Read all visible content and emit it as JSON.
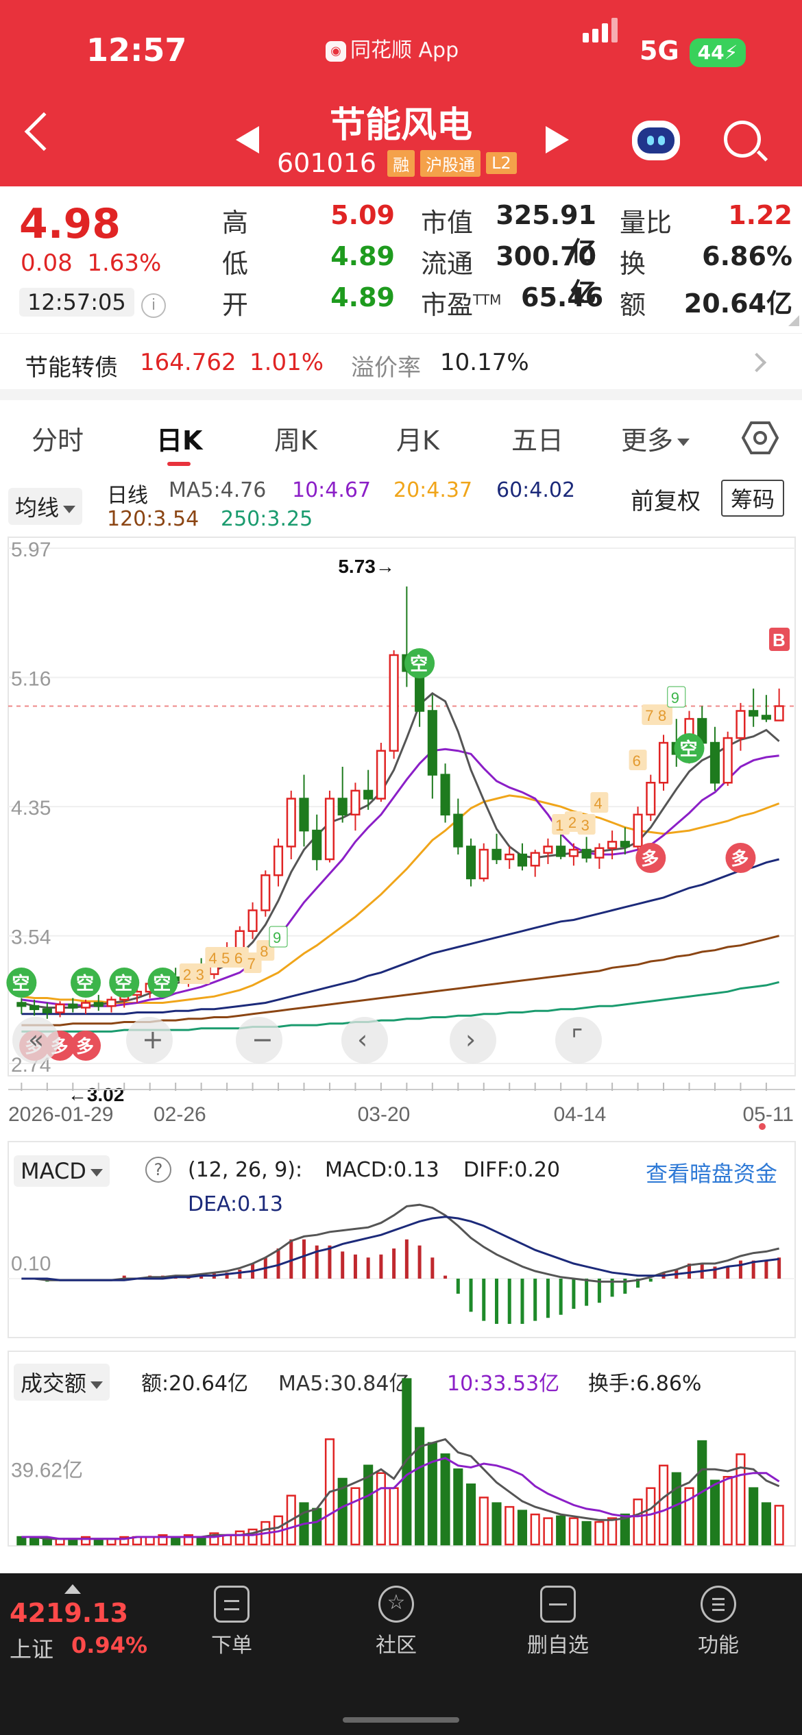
{
  "status_bar": {
    "time": "12:57",
    "app": "同花顺 App",
    "app_icon": "ths-logo",
    "network": "5G",
    "battery": "44"
  },
  "header": {
    "name": "节能风电",
    "code": "601016",
    "tags": [
      "融",
      "沪股通",
      "L2"
    ]
  },
  "quote": {
    "price": "4.98",
    "change": "0.08",
    "change_pct": "1.63%",
    "time": "12:57:05",
    "high_label": "高",
    "high": "5.09",
    "low_label": "低",
    "low": "4.89",
    "open_label": "开",
    "open": "4.89",
    "mktcap_label": "市值",
    "mktcap": "325.91亿",
    "float_label": "流通",
    "float": "300.70亿",
    "pe_label": "市盈",
    "pe_sup": "TTM",
    "pe": "65.46",
    "vr_label": "量比",
    "vr": "1.22",
    "turnover_label": "换",
    "turnover": "6.86%",
    "amount_label": "额",
    "amount": "20.64亿"
  },
  "bond": {
    "name": "节能转债",
    "price": "164.762",
    "pct": "1.01%",
    "premium_label": "溢价率",
    "premium": "10.17%"
  },
  "tabs": [
    "分时",
    "日K",
    "周K",
    "月K",
    "五日",
    "更多"
  ],
  "active_tab": "日K",
  "kline_header": {
    "selector": "均线",
    "label": "日线",
    "ma5": "MA5:4.76",
    "ma10": "10:4.67",
    "ma20": "20:4.37",
    "ma60": "60:4.02",
    "ma120": "120:3.54",
    "ma250": "250:3.25",
    "adjust": "前复权",
    "chip": "筹码"
  },
  "colors": {
    "up": "#e02424",
    "down": "#1e7b1e",
    "ma5": "#555555",
    "ma10": "#8b1fc7",
    "ma20": "#f0a51a",
    "ma60": "#1c2a7a",
    "ma120": "#8b4513",
    "ma250": "#1a9b6e"
  },
  "chart_data": [
    {
      "type": "candlestick",
      "title": "",
      "y_ticks": [
        "5.97",
        "5.16",
        "4.35",
        "3.54",
        "2.74"
      ],
      "ylim": [
        2.74,
        5.97
      ],
      "x_ticks": [
        "2026-01-29",
        "02-26",
        "03-20",
        "04-14",
        "05-11"
      ],
      "annotations": {
        "high_label": "5.73→",
        "low_label": "←3.02",
        "signal_empty": "空",
        "signal_long": "多",
        "signal_b": "B"
      },
      "counts": [
        "2",
        "3",
        "4",
        "5",
        "6",
        "7",
        "8",
        "9",
        "1",
        "2",
        "3",
        "4",
        "6",
        "7",
        "8",
        "9"
      ],
      "candles": [
        [
          3.12,
          3.15,
          3.05,
          3.1
        ],
        [
          3.1,
          3.14,
          3.04,
          3.08
        ],
        [
          3.08,
          3.12,
          3.02,
          3.06
        ],
        [
          3.06,
          3.13,
          3.03,
          3.11
        ],
        [
          3.11,
          3.15,
          3.06,
          3.09
        ],
        [
          3.09,
          3.14,
          3.05,
          3.12
        ],
        [
          3.12,
          3.17,
          3.07,
          3.1
        ],
        [
          3.1,
          3.16,
          3.06,
          3.14
        ],
        [
          3.14,
          3.2,
          3.09,
          3.17
        ],
        [
          3.17,
          3.22,
          3.12,
          3.19
        ],
        [
          3.19,
          3.26,
          3.15,
          3.24
        ],
        [
          3.24,
          3.3,
          3.18,
          3.28
        ],
        [
          3.28,
          3.34,
          3.22,
          3.26
        ],
        [
          3.26,
          3.36,
          3.22,
          3.33
        ],
        [
          3.33,
          3.4,
          3.28,
          3.3
        ],
        [
          3.3,
          3.44,
          3.27,
          3.41
        ],
        [
          3.41,
          3.5,
          3.36,
          3.46
        ],
        [
          3.46,
          3.6,
          3.42,
          3.57
        ],
        [
          3.57,
          3.75,
          3.52,
          3.7
        ],
        [
          3.7,
          3.95,
          3.66,
          3.92
        ],
        [
          3.92,
          4.15,
          3.85,
          4.1
        ],
        [
          4.1,
          4.45,
          4.02,
          4.4
        ],
        [
          4.4,
          4.55,
          4.1,
          4.2
        ],
        [
          4.2,
          4.3,
          3.95,
          4.02
        ],
        [
          4.02,
          4.45,
          4.0,
          4.4
        ],
        [
          4.4,
          4.6,
          4.25,
          4.3
        ],
        [
          4.3,
          4.5,
          4.2,
          4.45
        ],
        [
          4.45,
          4.58,
          4.33,
          4.4
        ],
        [
          4.4,
          4.75,
          4.38,
          4.7
        ],
        [
          4.7,
          5.33,
          4.65,
          5.3
        ],
        [
          5.3,
          5.73,
          5.1,
          5.2
        ],
        [
          5.2,
          5.27,
          4.85,
          4.95
        ],
        [
          4.95,
          5.05,
          4.4,
          4.55
        ],
        [
          4.55,
          4.62,
          4.25,
          4.3
        ],
        [
          4.3,
          4.4,
          4.05,
          4.1
        ],
        [
          4.1,
          4.15,
          3.85,
          3.9
        ],
        [
          3.9,
          4.12,
          3.88,
          4.08
        ],
        [
          4.08,
          4.18,
          3.99,
          4.02
        ],
        [
          4.02,
          4.1,
          3.96,
          4.05
        ],
        [
          4.05,
          4.12,
          3.95,
          3.98
        ],
        [
          3.98,
          4.08,
          3.91,
          4.06
        ],
        [
          4.06,
          4.15,
          3.99,
          4.1
        ],
        [
          4.1,
          4.18,
          4.02,
          4.04
        ],
        [
          4.04,
          4.12,
          3.98,
          4.08
        ],
        [
          4.08,
          4.16,
          4.0,
          4.03
        ],
        [
          4.03,
          4.12,
          3.96,
          4.09
        ],
        [
          4.09,
          4.2,
          4.02,
          4.13
        ],
        [
          4.13,
          4.22,
          4.05,
          4.1
        ],
        [
          4.1,
          4.35,
          4.08,
          4.3
        ],
        [
          4.3,
          4.55,
          4.26,
          4.5
        ],
        [
          4.5,
          4.8,
          4.45,
          4.75
        ],
        [
          4.75,
          4.9,
          4.6,
          4.68
        ],
        [
          4.68,
          4.95,
          4.62,
          4.9
        ],
        [
          4.9,
          4.98,
          4.7,
          4.75
        ],
        [
          4.75,
          4.85,
          4.45,
          4.5
        ],
        [
          4.5,
          4.82,
          4.48,
          4.78
        ],
        [
          4.78,
          5.0,
          4.7,
          4.95
        ],
        [
          4.95,
          5.09,
          4.85,
          4.92
        ],
        [
          4.92,
          5.05,
          4.88,
          4.9
        ],
        [
          4.89,
          5.09,
          4.89,
          4.98
        ]
      ],
      "ma_series": {
        "ma5": [
          3.12,
          3.1,
          3.09,
          3.09,
          3.09,
          3.1,
          3.11,
          3.12,
          3.13,
          3.15,
          3.18,
          3.21,
          3.24,
          3.27,
          3.29,
          3.32,
          3.36,
          3.42,
          3.5,
          3.61,
          3.76,
          3.94,
          4.08,
          4.17,
          4.25,
          4.28,
          4.32,
          4.36,
          4.44,
          4.58,
          4.78,
          4.99,
          5.06,
          5.01,
          4.82,
          4.58,
          4.39,
          4.21,
          4.1,
          4.04,
          4.03,
          4.04,
          4.05,
          4.06,
          4.07,
          4.07,
          4.08,
          4.09,
          4.13,
          4.22,
          4.34,
          4.46,
          4.57,
          4.64,
          4.68,
          4.73,
          4.77,
          4.79,
          4.83,
          4.76
        ],
        "ma10": [
          3.14,
          3.13,
          3.12,
          3.11,
          3.11,
          3.1,
          3.1,
          3.1,
          3.11,
          3.12,
          3.14,
          3.15,
          3.18,
          3.2,
          3.22,
          3.25,
          3.28,
          3.31,
          3.37,
          3.44,
          3.53,
          3.64,
          3.75,
          3.84,
          3.93,
          4.02,
          4.13,
          4.22,
          4.3,
          4.41,
          4.52,
          4.62,
          4.7,
          4.71,
          4.7,
          4.68,
          4.59,
          4.51,
          4.47,
          4.44,
          4.4,
          4.3,
          4.18,
          4.1,
          4.06,
          4.05,
          4.05,
          4.06,
          4.08,
          4.11,
          4.17,
          4.24,
          4.31,
          4.39,
          4.44,
          4.52,
          4.6,
          4.64,
          4.66,
          4.67
        ],
        "ma20": [
          3.16,
          3.15,
          3.15,
          3.14,
          3.14,
          3.13,
          3.13,
          3.12,
          3.12,
          3.12,
          3.12,
          3.12,
          3.13,
          3.14,
          3.15,
          3.16,
          3.18,
          3.2,
          3.23,
          3.27,
          3.31,
          3.37,
          3.43,
          3.48,
          3.54,
          3.6,
          3.66,
          3.73,
          3.8,
          3.88,
          3.96,
          4.05,
          4.14,
          4.2,
          4.27,
          4.34,
          4.38,
          4.4,
          4.42,
          4.41,
          4.39,
          4.37,
          4.35,
          4.32,
          4.3,
          4.28,
          4.25,
          4.22,
          4.2,
          4.19,
          4.18,
          4.19,
          4.2,
          4.22,
          4.24,
          4.26,
          4.29,
          4.31,
          4.34,
          4.37
        ],
        "ma60": [
          3.05,
          3.05,
          3.05,
          3.05,
          3.05,
          3.05,
          3.05,
          3.05,
          3.05,
          3.06,
          3.06,
          3.06,
          3.07,
          3.07,
          3.08,
          3.08,
          3.09,
          3.1,
          3.11,
          3.12,
          3.14,
          3.16,
          3.18,
          3.2,
          3.22,
          3.24,
          3.26,
          3.29,
          3.31,
          3.34,
          3.37,
          3.4,
          3.43,
          3.45,
          3.47,
          3.49,
          3.51,
          3.53,
          3.55,
          3.57,
          3.59,
          3.61,
          3.63,
          3.64,
          3.66,
          3.68,
          3.7,
          3.72,
          3.74,
          3.76,
          3.78,
          3.81,
          3.84,
          3.86,
          3.89,
          3.92,
          3.95,
          3.97,
          4.0,
          4.02
        ],
        "ma120": [
          2.98,
          2.98,
          2.98,
          2.98,
          2.99,
          2.99,
          2.99,
          2.99,
          3.0,
          3.0,
          3.0,
          3.01,
          3.01,
          3.02,
          3.02,
          3.03,
          3.03,
          3.04,
          3.05,
          3.06,
          3.07,
          3.08,
          3.09,
          3.1,
          3.11,
          3.12,
          3.13,
          3.14,
          3.15,
          3.16,
          3.17,
          3.18,
          3.19,
          3.2,
          3.21,
          3.22,
          3.23,
          3.24,
          3.25,
          3.26,
          3.27,
          3.28,
          3.29,
          3.3,
          3.31,
          3.32,
          3.34,
          3.35,
          3.36,
          3.38,
          3.39,
          3.41,
          3.42,
          3.44,
          3.45,
          3.47,
          3.48,
          3.5,
          3.52,
          3.54
        ],
        "ma250": [
          2.94,
          2.94,
          2.94,
          2.94,
          2.94,
          2.94,
          2.94,
          2.94,
          2.95,
          2.95,
          2.95,
          2.95,
          2.95,
          2.95,
          2.96,
          2.96,
          2.96,
          2.96,
          2.97,
          2.97,
          2.97,
          2.98,
          2.98,
          2.98,
          2.99,
          2.99,
          3.0,
          3.0,
          3.01,
          3.01,
          3.02,
          3.02,
          3.03,
          3.03,
          3.04,
          3.04,
          3.05,
          3.05,
          3.06,
          3.06,
          3.07,
          3.07,
          3.08,
          3.08,
          3.09,
          3.1,
          3.1,
          3.11,
          3.12,
          3.13,
          3.14,
          3.15,
          3.16,
          3.17,
          3.18,
          3.19,
          3.21,
          3.22,
          3.23,
          3.25
        ]
      }
    },
    {
      "type": "macd",
      "selector": "MACD",
      "params": "(12, 26, 9):",
      "macd_label": "MACD:0.13",
      "diff_label": "DIFF:0.20",
      "dea_label": "DEA:0.13",
      "link": "查看暗盘资金",
      "y_tick": "0.10",
      "diff": [
        0.0,
        0.0,
        -0.01,
        -0.01,
        -0.01,
        -0.01,
        -0.01,
        -0.01,
        0.0,
        0.0,
        0.01,
        0.01,
        0.02,
        0.02,
        0.03,
        0.04,
        0.05,
        0.07,
        0.1,
        0.14,
        0.19,
        0.25,
        0.28,
        0.29,
        0.31,
        0.32,
        0.33,
        0.34,
        0.37,
        0.42,
        0.48,
        0.49,
        0.47,
        0.42,
        0.35,
        0.27,
        0.21,
        0.16,
        0.12,
        0.08,
        0.05,
        0.03,
        0.01,
        0.0,
        -0.01,
        -0.02,
        -0.02,
        -0.02,
        -0.01,
        0.01,
        0.04,
        0.06,
        0.09,
        0.1,
        0.1,
        0.12,
        0.15,
        0.17,
        0.18,
        0.2
      ],
      "dea": [
        0.0,
        0.0,
        0.0,
        -0.01,
        -0.01,
        -0.01,
        -0.01,
        -0.01,
        -0.01,
        0.0,
        0.0,
        0.0,
        0.01,
        0.01,
        0.02,
        0.02,
        0.03,
        0.04,
        0.05,
        0.07,
        0.09,
        0.12,
        0.15,
        0.18,
        0.2,
        0.23,
        0.25,
        0.27,
        0.29,
        0.32,
        0.35,
        0.38,
        0.4,
        0.41,
        0.4,
        0.38,
        0.35,
        0.31,
        0.27,
        0.23,
        0.19,
        0.16,
        0.13,
        0.1,
        0.08,
        0.06,
        0.04,
        0.03,
        0.02,
        0.02,
        0.02,
        0.03,
        0.04,
        0.05,
        0.06,
        0.08,
        0.09,
        0.11,
        0.12,
        0.13
      ]
    },
    {
      "type": "bar",
      "selector": "成交额",
      "amount_label": "额:20.64亿",
      "ma5_label": "MA5:30.84亿",
      "ma10_label": "10:33.53亿",
      "turnover_label": "换手:6.86%",
      "y_tick": "39.62亿",
      "ylim": [
        0,
        78
      ],
      "values": [
        4,
        3,
        3,
        3,
        3,
        4,
        3,
        3,
        4,
        4,
        4,
        5,
        4,
        5,
        4,
        6,
        5,
        7,
        8,
        12,
        15,
        26,
        22,
        19,
        56,
        35,
        30,
        42,
        38,
        30,
        88,
        62,
        54,
        48,
        40,
        32,
        25,
        22,
        20,
        18,
        16,
        14,
        15,
        14,
        12,
        12,
        14,
        16,
        24,
        30,
        42,
        38,
        30,
        55,
        34,
        36,
        48,
        30,
        22,
        20.64
      ],
      "ma5": [
        4,
        4,
        3,
        3,
        3,
        3,
        3,
        3,
        3,
        4,
        4,
        4,
        4,
        4,
        4,
        5,
        5,
        5,
        6,
        8,
        9,
        13,
        17,
        19,
        28,
        30,
        33,
        36,
        40,
        35,
        45,
        52,
        54,
        56,
        49,
        47,
        40,
        33,
        28,
        23,
        20,
        18,
        16,
        15,
        14,
        13,
        13,
        14,
        16,
        19,
        25,
        30,
        33,
        40,
        40,
        39,
        41,
        40,
        34,
        31
      ],
      "ma10": [
        4,
        4,
        4,
        3,
        3,
        3,
        3,
        3,
        3,
        4,
        4,
        4,
        4,
        4,
        4,
        4,
        5,
        5,
        5,
        6,
        7,
        9,
        11,
        12,
        16,
        20,
        23,
        26,
        30,
        30,
        37,
        41,
        44,
        46,
        42,
        41,
        43,
        42,
        40,
        37,
        31,
        27,
        24,
        21,
        19,
        18,
        16,
        15,
        15,
        16,
        18,
        21,
        24,
        28,
        32,
        35,
        37,
        38,
        38,
        33.53
      ]
    }
  ],
  "bottom_nav": {
    "index_value": "4219.13",
    "index_name": "上证",
    "index_pct": "0.94%",
    "items": [
      {
        "label": "下单",
        "icon": "order-icon"
      },
      {
        "label": "社区",
        "icon": "community-icon"
      },
      {
        "label": "删自选",
        "icon": "remove-watchlist-icon"
      },
      {
        "label": "功能",
        "icon": "menu-icon"
      }
    ]
  }
}
